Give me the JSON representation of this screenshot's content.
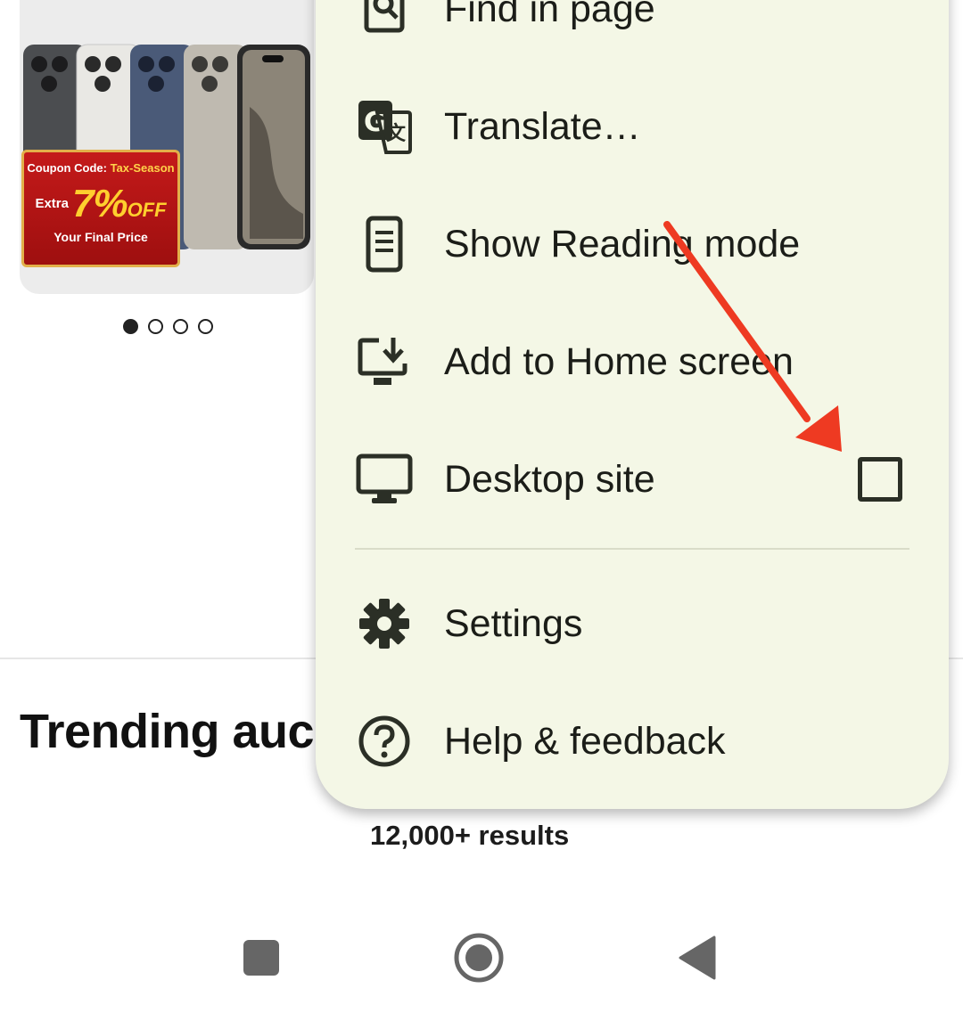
{
  "promo": {
    "coupon_prefix": "Coupon Code: ",
    "coupon_code": "Tax-Season",
    "extra_label": "Extra",
    "discount_value": "7%",
    "discount_suffix": "OFF",
    "final_price_label": "Your Final Price",
    "carousel": {
      "total": 4,
      "active": 0
    }
  },
  "page": {
    "section_title": "Trending auc",
    "results_count": "12,000+ results"
  },
  "menu": {
    "items": [
      {
        "label": "Find in page",
        "icon": "find-in-page-icon"
      },
      {
        "label": "Translate…",
        "icon": "translate-icon"
      },
      {
        "label": "Show Reading mode",
        "icon": "reading-mode-icon"
      },
      {
        "label": "Add to Home screen",
        "icon": "add-to-home-screen-icon"
      },
      {
        "label": "Desktop site",
        "icon": "desktop-icon",
        "checkbox": false
      },
      {
        "label": "Settings",
        "icon": "gear-icon"
      },
      {
        "label": "Help & feedback",
        "icon": "help-icon"
      }
    ]
  },
  "colors": {
    "menu_background": "#f4f7e6",
    "annotation_arrow": "#ee3a22",
    "coupon_red": "#c41a1a",
    "coupon_gold": "#ffcf2e"
  },
  "navbar": {
    "buttons": [
      "recents-square-icon",
      "home-circle-icon",
      "back-triangle-icon"
    ]
  }
}
